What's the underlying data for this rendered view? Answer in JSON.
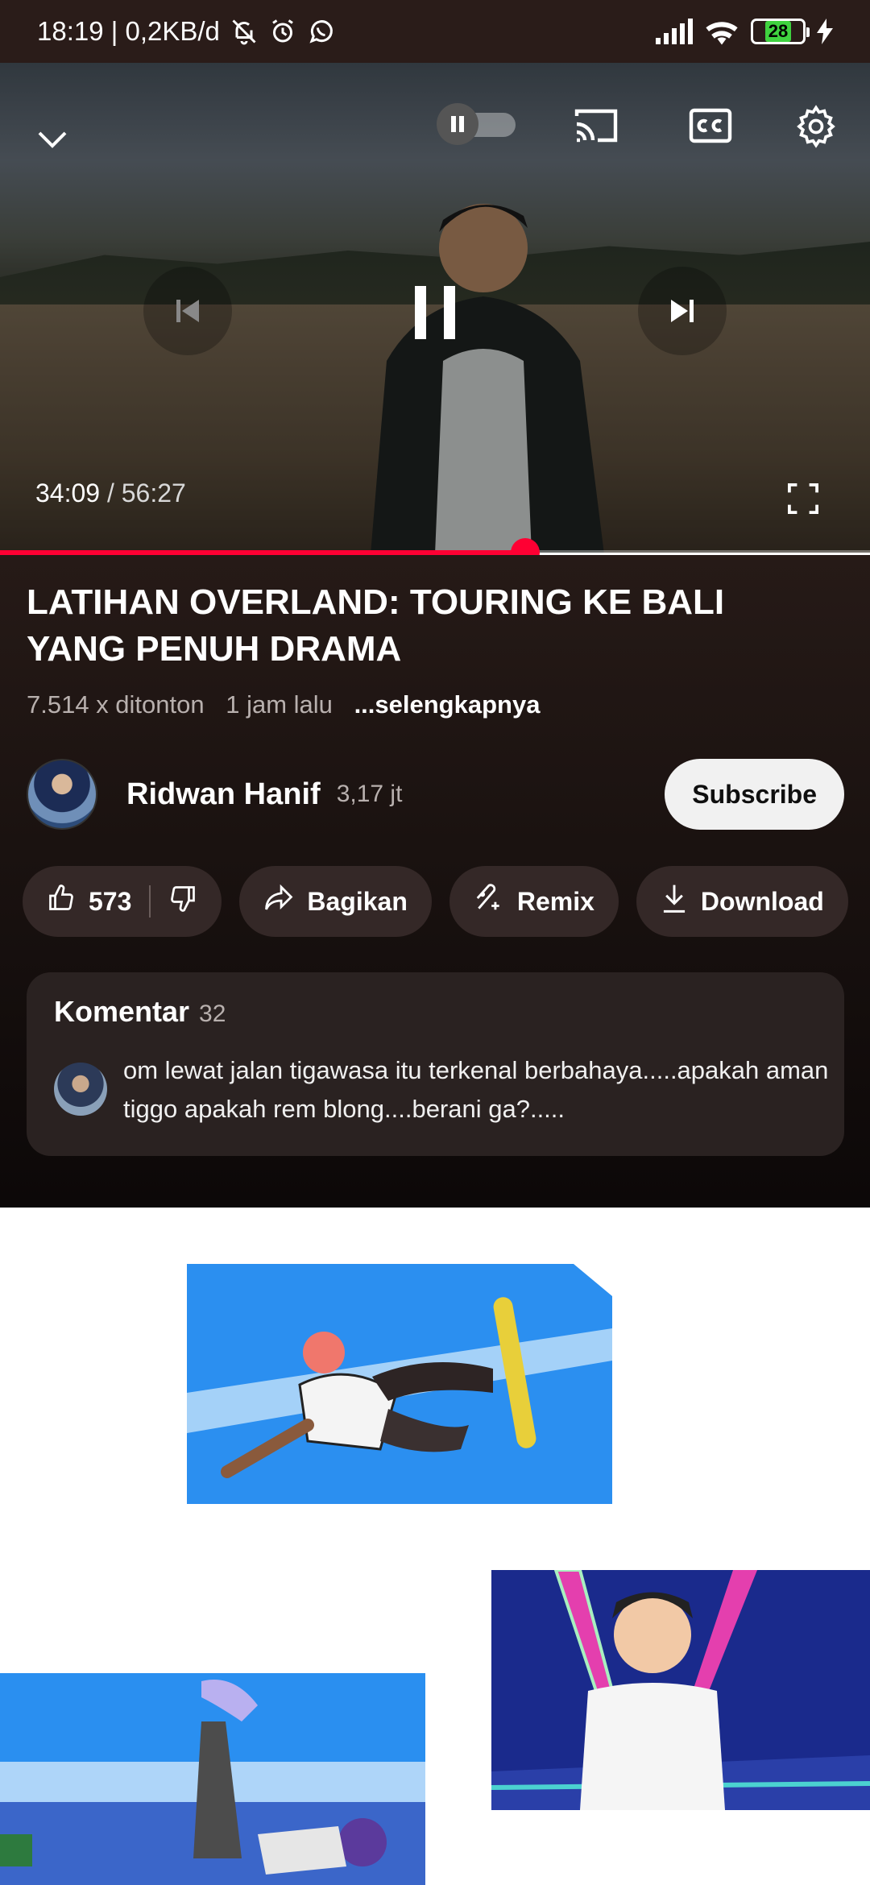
{
  "status_bar": {
    "time_speed": "18:19 | 0,2KB/d",
    "battery": "28"
  },
  "player": {
    "current_time": "34:09",
    "separator": " / ",
    "duration": "56:27",
    "progress_fraction": 0.604,
    "icons": [
      "chevron-down-icon",
      "autoplay-toggle",
      "cast-icon",
      "captions-icon",
      "settings-icon",
      "previous-icon",
      "pause-icon",
      "next-icon",
      "fullscreen-icon"
    ]
  },
  "video": {
    "title": "LATIHAN OVERLAND: TOURING KE BALI YANG PENUH DRAMA",
    "views": "7.514 x ditonton",
    "age": "1 jam lalu",
    "more": "...selengkapnya"
  },
  "channel": {
    "name": "Ridwan Hanif",
    "subscribers": "3,17 jt",
    "subscribe_label": "Subscribe"
  },
  "actions": {
    "likes": "573",
    "share": "Bagikan",
    "remix": "Remix",
    "download": "Download"
  },
  "comments": {
    "label": "Komentar",
    "count": "32",
    "top_comment": "om lewat jalan tigawasa itu terkenal berbahaya.....apakah aman tiggo apakah rem blong....berani ga?....."
  },
  "colors": {
    "accent": "#ff0033",
    "panel_bg": "#1a1210",
    "pill_bg": "#342827"
  }
}
